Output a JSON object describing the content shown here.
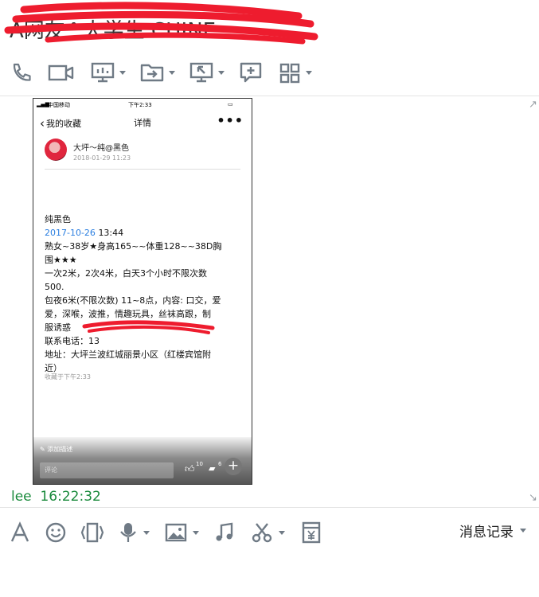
{
  "header": {
    "title": "A网友^大学生 CHINE"
  },
  "toolbar": {
    "items": [
      {
        "name": "phone-icon"
      },
      {
        "name": "video-icon"
      },
      {
        "name": "screen-share-icon"
      },
      {
        "name": "send-file-icon"
      },
      {
        "name": "remote-assist-icon"
      },
      {
        "name": "add-chat-icon"
      },
      {
        "name": "apps-grid-icon"
      }
    ]
  },
  "phone": {
    "status_carrier": "中国移动",
    "status_time": "下午2:33",
    "nav_back": "我的收藏",
    "nav_title": "详情",
    "nav_more": "•••",
    "user_name": "大坪～纯@黑色",
    "user_date": "2018-01-29 11:23",
    "post": {
      "title": "纯黑色",
      "date_link": "2017-10-26",
      "date_time": "13:44",
      "lines": [
        "熟女~38岁★身高165~~体重128~~38D胸",
        "围★★★",
        "一次2米，2次4米，白天3个小时不限次数",
        "500.",
        "包夜6米(不限次数) 11~8点，内容: 口交，爱",
        "爱，深喉，波推，情趣玩具，丝袜高跟，制",
        "服诱惑",
        "联系电话：13",
        "地址：大坪兰波红城丽景小区（红楼宾馆附",
        "近）"
      ]
    },
    "fav_time": "收藏于下午2:33",
    "add_desc": "添加描述",
    "comment_placeholder": "评论",
    "likes": "10",
    "comments": "6"
  },
  "message": {
    "sender": "lee",
    "time": "16:22:32"
  },
  "input_toolbar": {
    "items": [
      {
        "name": "font-icon"
      },
      {
        "name": "emoji-icon"
      },
      {
        "name": "shake-icon"
      },
      {
        "name": "voice-icon"
      },
      {
        "name": "image-icon"
      },
      {
        "name": "music-icon"
      },
      {
        "name": "screenshot-icon"
      },
      {
        "name": "red-packet-icon"
      }
    ],
    "history_label": "消息记录"
  },
  "colors": {
    "accent_green": "#1a8a3c",
    "link_blue": "#2a7ee0",
    "scribble_red": "#ee1c2e",
    "icon_gray": "#6f7a85"
  }
}
